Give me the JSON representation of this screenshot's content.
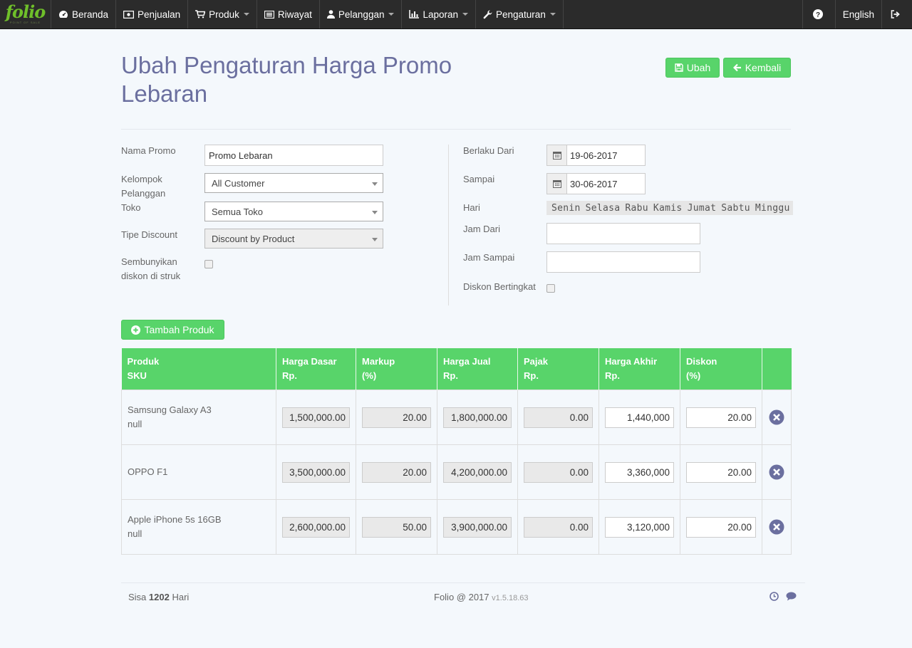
{
  "navbar": {
    "brand": "folio",
    "brand_tagline": "POINT OF SALE",
    "items": [
      {
        "label": "Beranda",
        "icon": "dashboard-icon",
        "dropdown": false
      },
      {
        "label": "Penjualan",
        "icon": "money-icon",
        "dropdown": false
      },
      {
        "label": "Produk",
        "icon": "cart-icon",
        "dropdown": true
      },
      {
        "label": "Riwayat",
        "icon": "list-icon",
        "dropdown": false
      },
      {
        "label": "Pelanggan",
        "icon": "user-icon",
        "dropdown": true
      },
      {
        "label": "Laporan",
        "icon": "chart-icon",
        "dropdown": true
      },
      {
        "label": "Pengaturan",
        "icon": "wrench-icon",
        "dropdown": true
      }
    ],
    "language": "English"
  },
  "page": {
    "title": "Ubah Pengaturan Harga Promo Lebaran",
    "btn_ubah": "Ubah",
    "btn_kembali": "Kembali"
  },
  "form": {
    "nama_promo_label": "Nama Promo",
    "nama_promo_value": "Promo Lebaran",
    "kelompok_label": "Kelompok Pelanggan",
    "kelompok_value": "All Customer",
    "toko_label": "Toko",
    "toko_value": "Semua Toko",
    "tipe_label": "Tipe Discount",
    "tipe_value": "Discount by Product",
    "sembunyikan_label": "Sembunyikan diskon di struk",
    "berlaku_label": "Berlaku Dari",
    "berlaku_value": "19-06-2017",
    "sampai_label": "Sampai",
    "sampai_value": "30-06-2017",
    "hari_label": "Hari",
    "days": [
      "Senin",
      "Selasa",
      "Rabu",
      "Kamis",
      "Jumat",
      "Sabtu",
      "Minggu"
    ],
    "jam_dari_label": "Jam Dari",
    "jam_dari_value": "",
    "jam_sampai_label": "Jam Sampai",
    "jam_sampai_value": "",
    "bertingkat_label": "Diskon Bertingkat"
  },
  "add_product_label": "Tambah Produk",
  "table": {
    "headers": [
      [
        "Produk",
        "SKU"
      ],
      [
        "Harga Dasar",
        "Rp."
      ],
      [
        "Markup",
        "(%)"
      ],
      [
        "Harga Jual",
        "Rp."
      ],
      [
        "Pajak",
        "Rp."
      ],
      [
        "Harga Akhir",
        "Rp."
      ],
      [
        "Diskon",
        "(%)"
      ]
    ],
    "rows": [
      {
        "name": "Samsung Galaxy A3",
        "sku": "null",
        "harga_dasar": "1,500,000.00",
        "markup": "20.00",
        "harga_jual": "1,800,000.00",
        "pajak": "0.00",
        "harga_akhir": "1,440,000",
        "diskon": "20.00"
      },
      {
        "name": "OPPO F1",
        "sku": "",
        "harga_dasar": "3,500,000.00",
        "markup": "20.00",
        "harga_jual": "4,200,000.00",
        "pajak": "0.00",
        "harga_akhir": "3,360,000",
        "diskon": "20.00"
      },
      {
        "name": "Apple iPhone 5s 16GB",
        "sku": "null",
        "harga_dasar": "2,600,000.00",
        "markup": "50.00",
        "harga_jual": "3,900,000.00",
        "pajak": "0.00",
        "harga_akhir": "3,120,000",
        "diskon": "20.00"
      }
    ]
  },
  "footer": {
    "sisa_prefix": "Sisa",
    "sisa_days": "1202",
    "sisa_suffix": "Hari",
    "copyright": "Folio @ 2017",
    "version": "v1.5.18.63"
  }
}
